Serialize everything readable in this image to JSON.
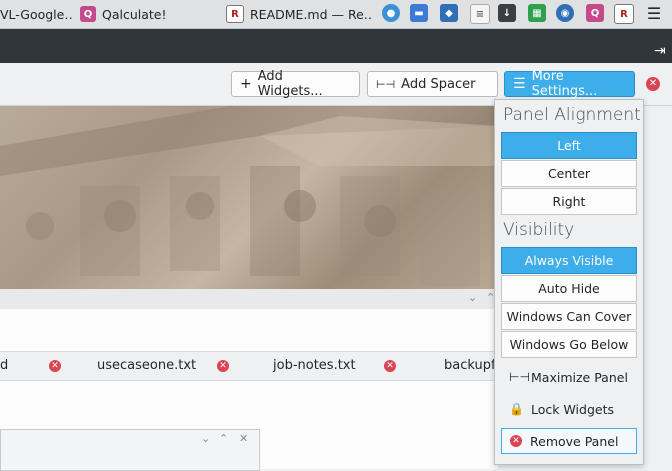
{
  "taskbar": {
    "tasks": [
      {
        "label": "VL-Google…",
        "icon": "browser-icon"
      },
      {
        "label": "Qalculate!",
        "icon": "qalculate-icon"
      },
      {
        "label": "README.md — Re…",
        "icon": "editor-icon"
      }
    ],
    "tray": [
      "globe-icon",
      "folder-icon",
      "cube-icon",
      "document-icon",
      "download-icon",
      "calendar-icon",
      "network-icon",
      "qalculate-icon",
      "editor-icon",
      "menu-icon"
    ]
  },
  "toolbar": {
    "add_widgets_label": "Add Widgets...",
    "add_spacer_label": "Add Spacer",
    "more_settings_label": "More Settings...",
    "close_label": "✕"
  },
  "settings": {
    "alignment_heading": "Panel Alignment",
    "alignment_options": [
      "Left",
      "Center",
      "Right"
    ],
    "alignment_selected": "Left",
    "visibility_heading": "Visibility",
    "visibility_options": [
      "Always Visible",
      "Auto Hide",
      "Windows Can Cover",
      "Windows Go Below"
    ],
    "visibility_selected": "Always Visible",
    "actions": [
      "Maximize Panel",
      "Lock Widgets",
      "Remove Panel"
    ]
  },
  "files": {
    "tabs": [
      "d",
      "usecaseone.txt",
      "job-notes.txt",
      "backupfi"
    ]
  },
  "colors": {
    "accent": "#3daee9",
    "danger": "#da4453"
  }
}
